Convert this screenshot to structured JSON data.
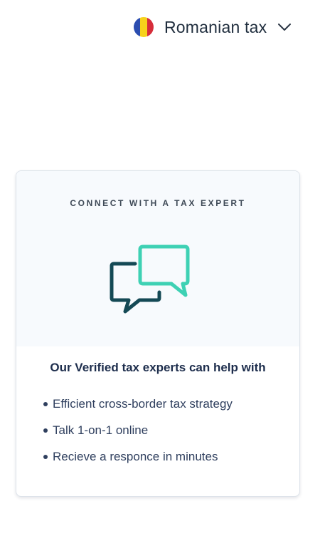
{
  "header": {
    "tax_selector": {
      "label": "Romanian tax",
      "flag_icon": "romania-flag-icon",
      "flag_colors": [
        "#2b4db0",
        "#f7d21b",
        "#d62d3a"
      ],
      "chevron_icon": "chevron-down-icon"
    }
  },
  "card": {
    "heading": "CONNECT WITH A TAX EXPERT",
    "illustration_icon": "chat-bubbles-icon",
    "illustration_colors": {
      "back_bubble": "#144955",
      "front_bubble": "#3ed1b4"
    },
    "title": "Our Verified tax experts can help with",
    "bullets": [
      "Efficient cross-border tax strategy",
      "Talk 1-on-1 online",
      "Recieve a responce in minutes"
    ]
  }
}
